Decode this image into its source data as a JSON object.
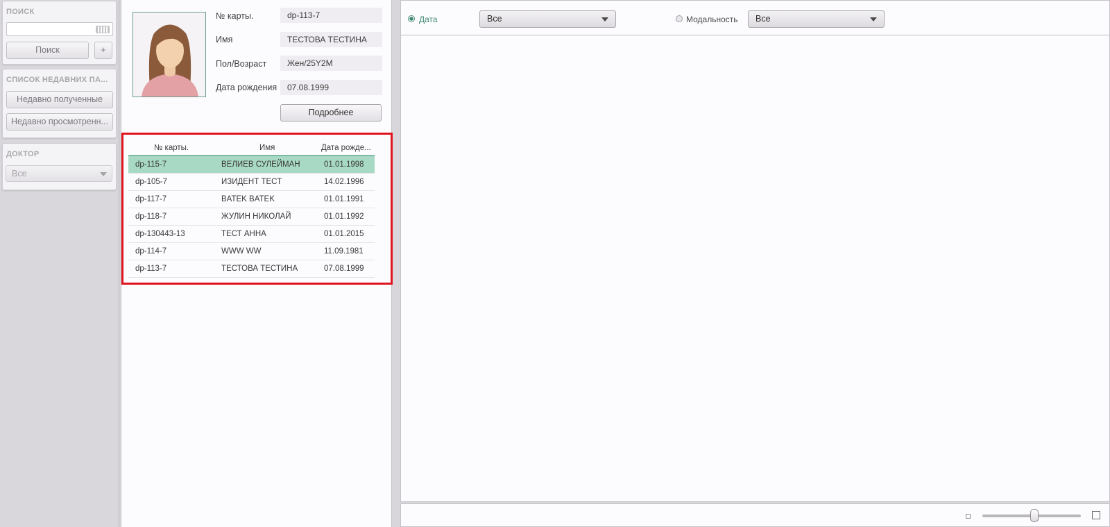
{
  "sidebar": {
    "search": {
      "title": "ПОИСК",
      "button": "Поиск",
      "add": "+"
    },
    "recent": {
      "title": "СПИСОК НЕДАВНИХ ПА...",
      "received": "Недавно полученные",
      "viewed": "Недавно просмотренн..."
    },
    "doctor": {
      "title": "ДОКТОР",
      "selected": "Все"
    }
  },
  "patient": {
    "card_label": "№ карты.",
    "card_value": "dp-113-7",
    "name_label": "Имя",
    "name_value": "ТЕСТОВА ТЕСТИНА",
    "sex_label": "Пол/Возраст",
    "sex_value": "Жен/25Y2M",
    "dob_label": "Дата рождения",
    "dob_value": "07.08.1999",
    "details_button": "Подробнее"
  },
  "table": {
    "headers": [
      "№ карты.",
      "Имя",
      "Дата рожде..."
    ],
    "rows": [
      [
        "dp-115-7",
        "ВЕЛИЕВ СУЛЕЙМАН",
        "01.01.1998"
      ],
      [
        "dp-105-7",
        "ИЗИДЕНТ ТЕСТ",
        "14.02.1996"
      ],
      [
        "dp-117-7",
        "BATEK BATEK",
        "01.01.1991"
      ],
      [
        "dp-118-7",
        "ЖУЛИН НИКОЛАЙ",
        "01.01.1992"
      ],
      [
        "dp-130443-13",
        "ТЕСТ АННА",
        "01.01.2015"
      ],
      [
        "dp-114-7",
        "WWW WW",
        "11.09.1981"
      ],
      [
        "dp-113-7",
        "ТЕСТОВА ТЕСТИНА",
        "07.08.1999"
      ]
    ]
  },
  "filters": {
    "date_label": "Дата",
    "date_value": "Все",
    "modality_label": "Модальность",
    "modality_value": "Все"
  },
  "colors": {
    "accent": "#3f8a71",
    "selected_row": "#a8d9c4",
    "highlight_border": "#e0141e"
  }
}
